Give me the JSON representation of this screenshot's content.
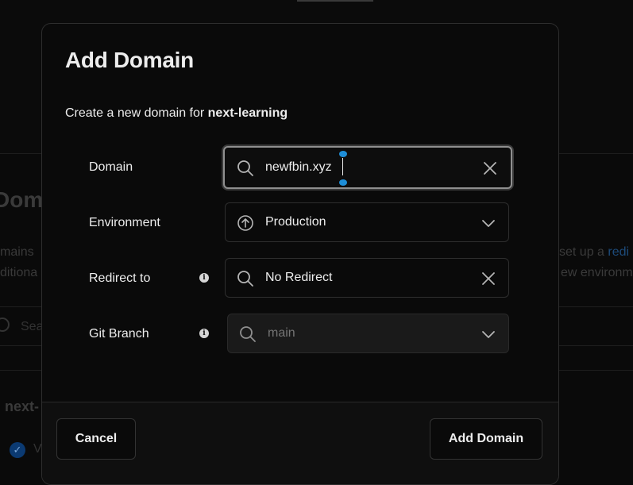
{
  "background": {
    "page_title": "Doma",
    "line1_left": "mains",
    "line1_right": "set up a",
    "line1_link": "redi",
    "line2_left": "ditiona",
    "line2_right": "ew environm",
    "search_placeholder": "Sea",
    "project_name": "next-",
    "status_text": "V"
  },
  "modal": {
    "title": "Add Domain",
    "description_prefix": "Create a new domain for",
    "project": "next-learning",
    "domain": {
      "label": "Domain",
      "value": "newfbin.xyz"
    },
    "environment": {
      "label": "Environment",
      "value": "Production"
    },
    "redirect": {
      "label": "Redirect to",
      "value": "No Redirect"
    },
    "git_branch": {
      "label": "Git Branch",
      "placeholder": "main"
    },
    "cancel_label": "Cancel",
    "submit_label": "Add Domain"
  },
  "colors": {
    "background": "#0a0a0a",
    "text": "#ededed",
    "border": "#2e2e2e",
    "focus_ring": "#8f8f8f",
    "selection_handle": "#1e8ed8"
  }
}
